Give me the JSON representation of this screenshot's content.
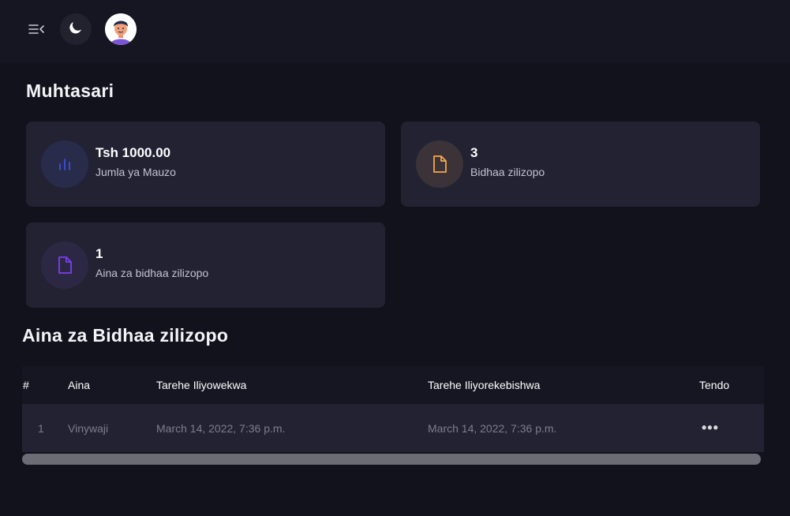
{
  "header": {
    "menu_icon": "menu-collapse-icon",
    "theme_icon": "moon-icon",
    "avatar_icon": "user-avatar"
  },
  "summary": {
    "title": "Muhtasari",
    "cards": [
      {
        "value": "Tsh 1000.00",
        "label": "Jumla ya Mauzo",
        "icon": "bar-chart-icon",
        "accent": "#3b4fd8",
        "icon_bg": "#282c4a"
      },
      {
        "value": "3",
        "label": "Bidhaa zilizopo",
        "icon": "file-icon",
        "accent": "#f5a94a",
        "icon_bg": "#3b3338"
      },
      {
        "value": "1",
        "label": "Aina za bidhaa zilizopo",
        "icon": "file-icon",
        "accent": "#7b3ff0",
        "icon_bg": "#2c2844"
      }
    ]
  },
  "table": {
    "title": "Aina za Bidhaa zilizopo",
    "columns": [
      "#",
      "Aina",
      "Tarehe Iliyowekwa",
      "Tarehe Iliyorekebishwa",
      "Tendo"
    ],
    "rows": [
      [
        "1",
        "Vinywaji",
        "March 14, 2022, 7:36 p.m.",
        "March 14, 2022, 7:36 p.m.",
        "•••"
      ]
    ]
  }
}
